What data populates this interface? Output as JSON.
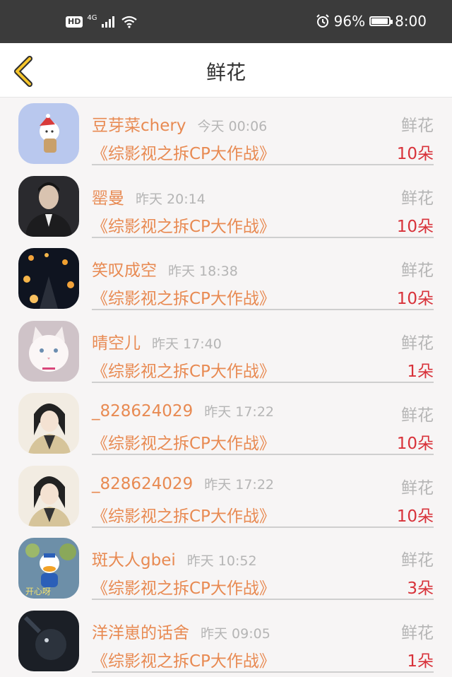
{
  "status_bar": {
    "hd": "HD",
    "network": "4G",
    "battery_percent": "96%",
    "battery_level": 0.96,
    "time": "8:00"
  },
  "header": {
    "title": "鲜花"
  },
  "items": [
    {
      "username": "豆芽菜chery",
      "time": "今天 00:06",
      "type": "鲜花",
      "book": "《综影视之拆CP大作战》",
      "count": "10朵",
      "avatar": "snowman-avatar"
    },
    {
      "username": "罂曼",
      "time": "昨天 20:14",
      "type": "鲜花",
      "book": "《综影视之拆CP大作战》",
      "count": "10朵",
      "avatar": "man-photo-avatar"
    },
    {
      "username": "笑叹成空",
      "time": "昨天 18:38",
      "type": "鲜花",
      "book": "《综影视之拆CP大作战》",
      "count": "10朵",
      "avatar": "lanterns-avatar"
    },
    {
      "username": "晴空儿",
      "time": "昨天 17:40",
      "type": "鲜花",
      "book": "《综影视之拆CP大作战》",
      "count": "1朵",
      "avatar": "cat-avatar"
    },
    {
      "username": "_828624029",
      "time": "昨天 17:22",
      "type": "鲜花",
      "book": "《综影视之拆CP大作战》",
      "count": "10朵",
      "avatar": "anime-avatar"
    },
    {
      "username": "_828624029",
      "time": "昨天 17:22",
      "type": "鲜花",
      "book": "《综影视之拆CP大作战》",
      "count": "10朵",
      "avatar": "anime-avatar"
    },
    {
      "username": "斑大人gbei",
      "time": "昨天 10:52",
      "type": "鲜花",
      "book": "《综影视之拆CP大作战》",
      "count": "3朵",
      "avatar": "donald-duck-avatar"
    },
    {
      "username": "洋洋崽的话舍",
      "time": "昨天 09:05",
      "type": "鲜花",
      "book": "《综影视之拆CP大作战》",
      "count": "1朵",
      "avatar": "dark-photo-avatar"
    }
  ]
}
